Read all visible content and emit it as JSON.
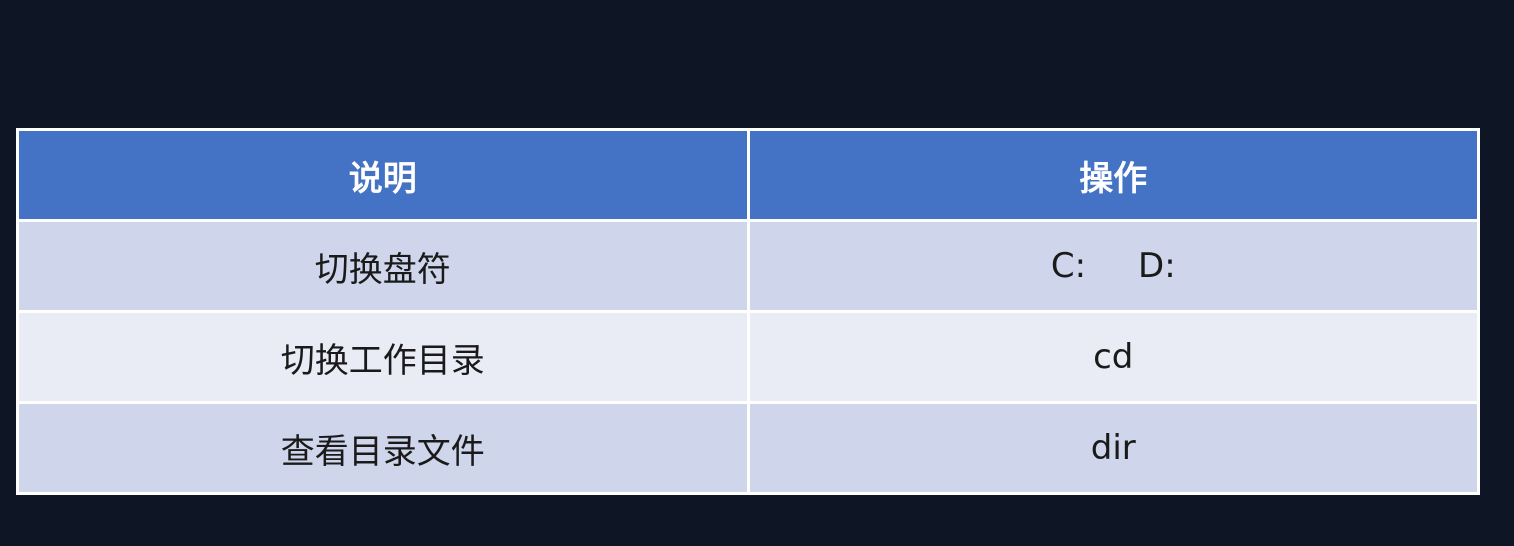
{
  "table": {
    "headers": {
      "description": "说明",
      "operation": "操作"
    },
    "rows": [
      {
        "description": "切换盘符",
        "operation": [
          "C:",
          "D:"
        ]
      },
      {
        "description": "切换工作目录",
        "operation": "cd"
      },
      {
        "description": "查看目录文件",
        "operation": "dir"
      }
    ]
  },
  "colors": {
    "background": "#0e1625",
    "header": "#4472c4",
    "row_dark": "#cfd5ea",
    "row_light": "#e9ebf5"
  }
}
